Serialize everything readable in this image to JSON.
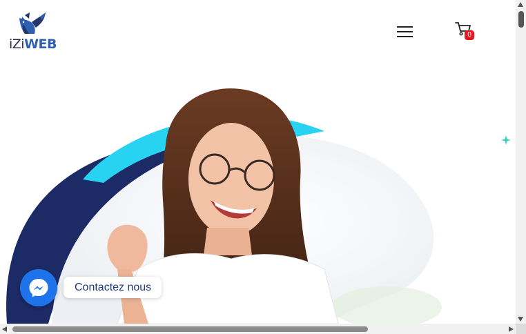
{
  "brand": {
    "part1": "iZi",
    "part2": "WEB",
    "colors": {
      "navy": "#24356b",
      "blue": "#2f5fb3"
    }
  },
  "header": {
    "menu_icon": "hamburger-menu-icon",
    "cart_icon": "shopping-cart-icon",
    "cart_count": "0",
    "cart_badge_color": "#e11b22"
  },
  "hero": {
    "image": "smiling-woman-with-glasses-celebrating",
    "shape_colors": [
      "#1c2a66",
      "#28d3f2",
      "#eef1f5"
    ],
    "sparkle_icon": "sparkle-icon",
    "sparkle_color": "#34d3c2"
  },
  "chat": {
    "icon": "messenger-icon",
    "label": "Contactez nous",
    "button_color": "#1f73ea"
  },
  "scrollbars": {
    "vertical_position": 0.0,
    "horizontal_visible_fraction": 0.7
  }
}
